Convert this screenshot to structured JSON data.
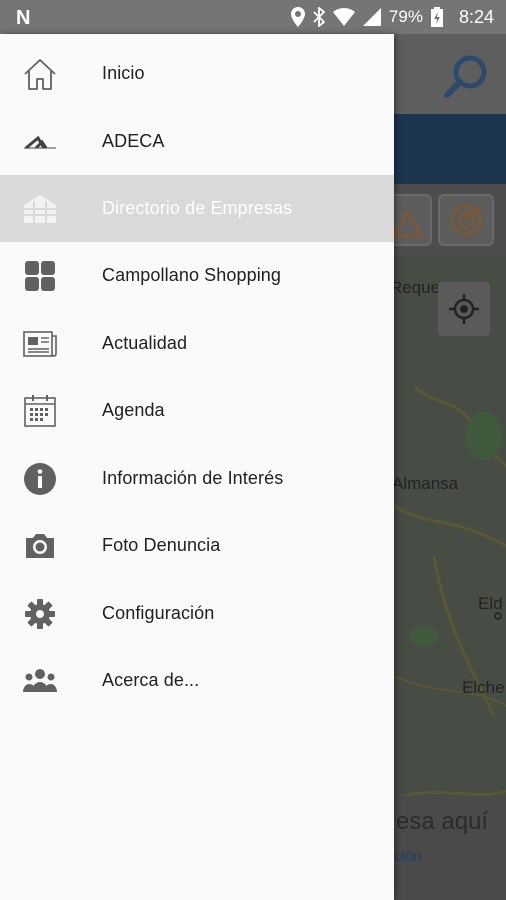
{
  "status_bar": {
    "battery": "79%",
    "time": "8:24"
  },
  "menu": {
    "items": [
      {
        "label": "Inicio",
        "icon": "home-icon",
        "active": false
      },
      {
        "label": "ADECA",
        "icon": "adeca-logo-icon",
        "active": false
      },
      {
        "label": "Directorio de Empresas",
        "icon": "buildings-icon",
        "active": true
      },
      {
        "label": "Campollano Shopping",
        "icon": "grid-icon",
        "active": false
      },
      {
        "label": "Actualidad",
        "icon": "newspaper-icon",
        "active": false
      },
      {
        "label": "Agenda",
        "icon": "calendar-icon",
        "active": false
      },
      {
        "label": "Información de Interés",
        "icon": "info-icon",
        "active": false
      },
      {
        "label": "Foto Denuncia",
        "icon": "camera-icon",
        "active": false
      },
      {
        "label": "Configuración",
        "icon": "gear-icon",
        "active": false
      },
      {
        "label": "Acerca de...",
        "icon": "group-icon",
        "active": false
      }
    ]
  },
  "background_app": {
    "map_labels": [
      "Requena",
      "Almansa",
      "Eld",
      "Elche"
    ],
    "banner_text": "esa aquí",
    "banner_link": "ción"
  },
  "colors": {
    "drawer_bg": "#fafafa",
    "active_bg": "#d9d9d9",
    "status_bar": "#757575",
    "icon_gray": "#616161"
  }
}
